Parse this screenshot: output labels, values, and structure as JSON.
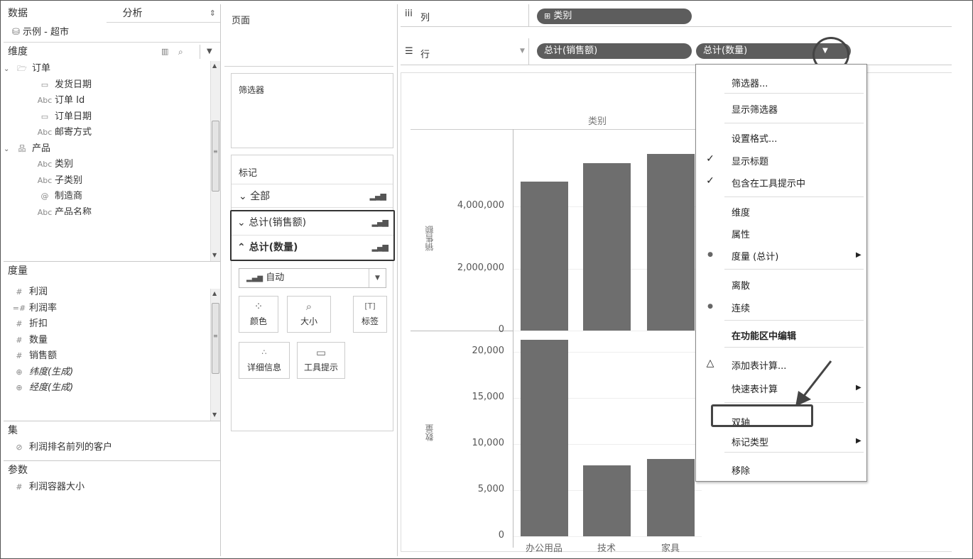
{
  "data_pane": {
    "tab_data": "数据",
    "tab_analysis": "分析",
    "datasource": "示例 - 超市",
    "dimensions_header": "维度",
    "dimensions": [
      {
        "label": "订单",
        "icon": "folder-icon",
        "kind": "folder"
      },
      {
        "label": "发货日期",
        "icon": "date-icon",
        "type": "日"
      },
      {
        "label": "订单 Id",
        "icon": "string-icon",
        "type": "Abc"
      },
      {
        "label": "订单日期",
        "icon": "date-icon",
        "type": "日"
      },
      {
        "label": "邮寄方式",
        "icon": "string-icon",
        "type": "Abc"
      },
      {
        "label": "产品",
        "icon": "hierarchy-icon",
        "kind": "folder"
      },
      {
        "label": "类别",
        "icon": "string-icon",
        "type": "Abc"
      },
      {
        "label": "子类别",
        "icon": "string-icon",
        "type": "Abc"
      },
      {
        "label": "制造商",
        "icon": "group-icon",
        "type": "@"
      },
      {
        "label": "产品名称",
        "icon": "string-icon",
        "type": "Abc"
      }
    ],
    "measures_header": "度量",
    "measures": [
      {
        "label": "利润",
        "type": "#"
      },
      {
        "label": "利润率",
        "type": "=#"
      },
      {
        "label": "折扣",
        "type": "#"
      },
      {
        "label": "数量",
        "type": "#"
      },
      {
        "label": "销售额",
        "type": "#"
      },
      {
        "label": "纬度(生成)",
        "type": "geo",
        "italic": true
      },
      {
        "label": "经度(生成)",
        "type": "geo",
        "italic": true
      }
    ],
    "sets_header": "集",
    "sets": [
      {
        "label": "利润排名前列的客户"
      }
    ],
    "params_header": "参数",
    "params": [
      {
        "label": "利润容器大小",
        "type": "#"
      }
    ]
  },
  "shelves": {
    "pages": "页面",
    "filters": "筛选器",
    "marks": "标记",
    "marks_all": "全部",
    "marks_sales": "总计(销售额)",
    "marks_qty": "总计(数量)",
    "mark_type": "自动",
    "mark_buttons": [
      "颜色",
      "大小",
      "标签",
      "详细信息",
      "工具提示"
    ],
    "columns_label": "列",
    "rows_label": "行",
    "columns_pills": [
      "类别"
    ],
    "rows_pills": [
      "总计(销售额)",
      "总计(数量)"
    ]
  },
  "chart_data": [
    {
      "type": "bar",
      "title": "",
      "header": "类别",
      "categories": [
        "办公用品",
        "技术",
        "家具"
      ],
      "ylabel": "销售额",
      "values": [
        4800000,
        5400000,
        5700000
      ],
      "ylim": [
        0,
        6500000
      ],
      "yticks": [
        "4,000,000",
        "2,000,000",
        "0"
      ]
    },
    {
      "type": "bar",
      "categories": [
        "办公用品",
        "技术",
        "家具"
      ],
      "ylabel": "数量",
      "values": [
        21300,
        7700,
        8400
      ],
      "ylim": [
        0,
        22000
      ],
      "yticks": [
        "20,000",
        "15,000",
        "10,000",
        "5,000",
        "0"
      ]
    }
  ],
  "context_menu": {
    "items": [
      {
        "label": "筛选器..."
      },
      {
        "label": "显示筛选器"
      },
      {
        "label": "设置格式..."
      },
      {
        "label": "显示标题",
        "mark": "✓"
      },
      {
        "label": "包含在工具提示中",
        "mark": "✓"
      },
      {
        "label": "维度"
      },
      {
        "label": "属性"
      },
      {
        "label": "度量 (总计)",
        "mark": "●",
        "submenu": true
      },
      {
        "label": "离散"
      },
      {
        "label": "连续",
        "mark": "●"
      },
      {
        "label": "在功能区中编辑",
        "bold": true
      },
      {
        "label": "添加表计算...",
        "mark": "△"
      },
      {
        "label": "快速表计算",
        "submenu": true
      },
      {
        "label": "双轴"
      },
      {
        "label": "标记类型",
        "submenu": true
      },
      {
        "label": "移除"
      }
    ]
  }
}
